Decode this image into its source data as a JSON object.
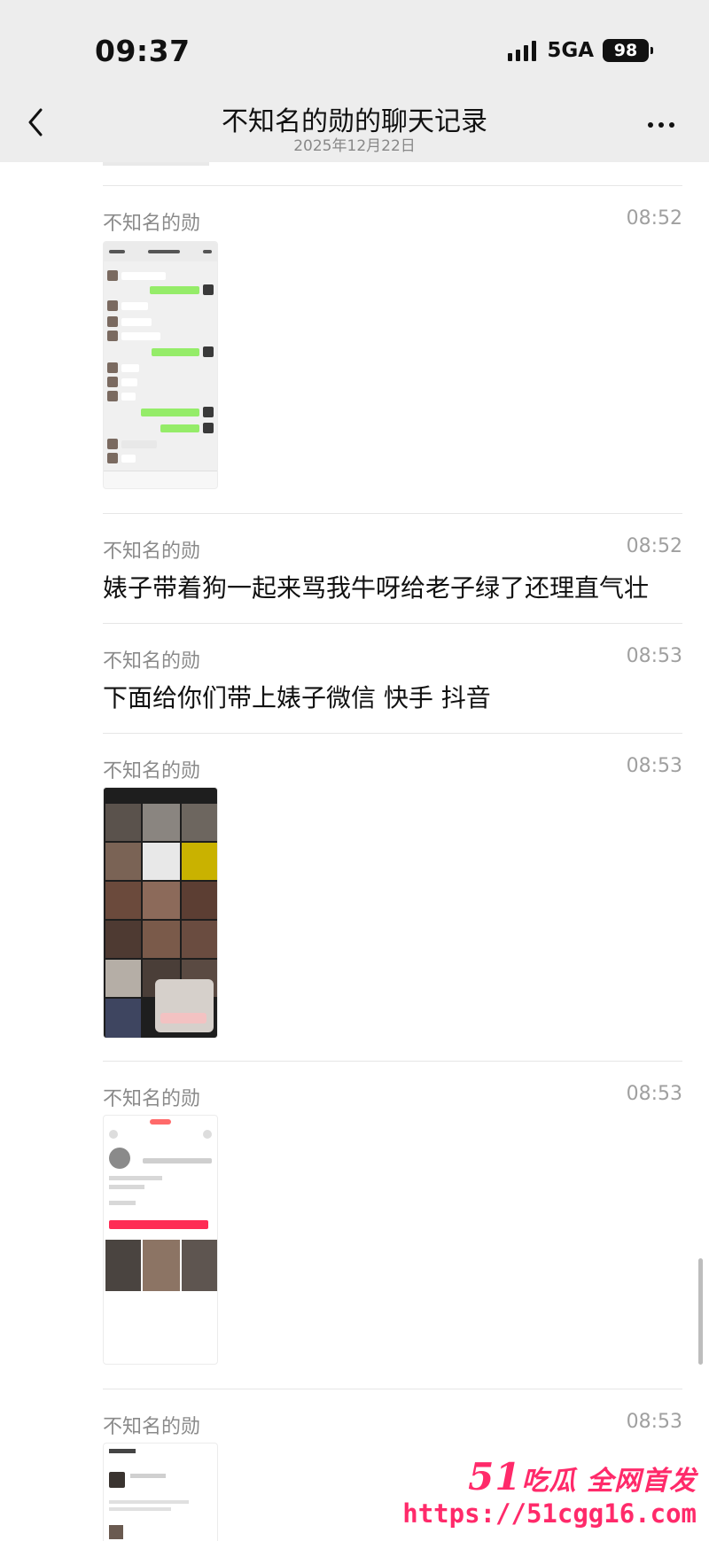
{
  "status": {
    "time": "09:37",
    "network": "5GA",
    "battery": "98"
  },
  "nav": {
    "title": "不知名的勋的聊天记录",
    "date": "2025年12月22日"
  },
  "messages": [
    {
      "sender": "不知名的勋",
      "time": "08:52",
      "kind": "image"
    },
    {
      "sender": "不知名的勋",
      "time": "08:52",
      "kind": "text",
      "text": "婊子带着狗一起来骂我牛呀给老子绿了还理直气壮"
    },
    {
      "sender": "不知名的勋",
      "time": "08:53",
      "kind": "text",
      "text": "下面给你们带上婊子微信 快手 抖音"
    },
    {
      "sender": "不知名的勋",
      "time": "08:53",
      "kind": "image"
    },
    {
      "sender": "不知名的勋",
      "time": "08:53",
      "kind": "image"
    },
    {
      "sender": "不知名的勋",
      "time": "08:53",
      "kind": "image"
    }
  ],
  "watermark": {
    "logo_num": "51",
    "logo_text": "吃瓜 全网首发",
    "url": "https://51cgg16.com"
  },
  "colors": {
    "accent": "#ff2a6a",
    "bubble_green": "#95ec69"
  }
}
